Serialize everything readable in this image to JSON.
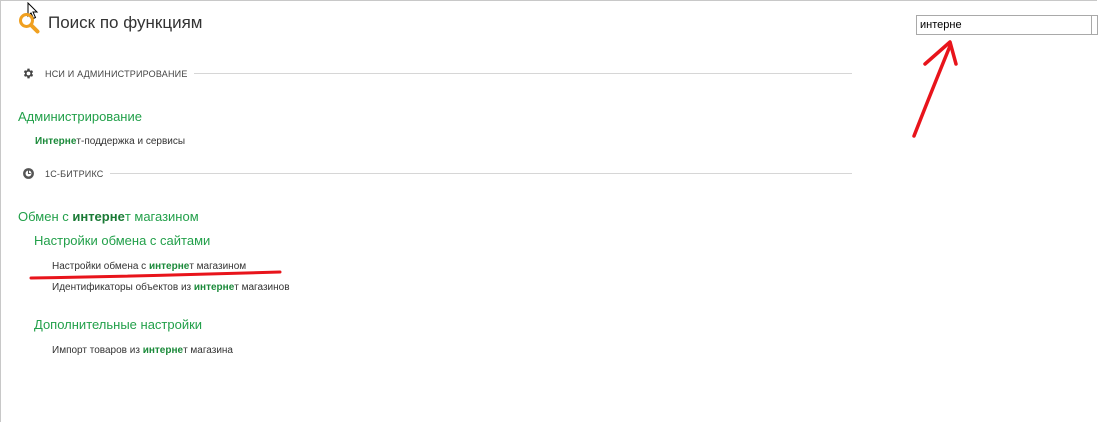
{
  "header": {
    "title": "Поиск по функциям",
    "icon": "search-icon"
  },
  "search": {
    "value": "интерне"
  },
  "sections": [
    {
      "label": "НСИ И АДМИНИСТРИРОВАНИЕ",
      "icon": "gear-icon"
    },
    {
      "label": "1С-БИТРИКС",
      "icon": "bitrix-icon"
    }
  ],
  "groups": {
    "admin": {
      "title": "Администрирование",
      "items": [
        {
          "match": "Интерне",
          "rest": "т-поддержка и сервисы"
        }
      ]
    },
    "exchange": {
      "title_pre": "Обмен с ",
      "title_match": "интерне",
      "title_post": "т магазином",
      "subgroups": [
        {
          "title": "Настройки обмена с сайтами",
          "items": [
            {
              "pre": "Настройки обмена с ",
              "match": "интерне",
              "post": "т магазином"
            },
            {
              "pre": "Идентификаторы объектов из ",
              "match": "интерне",
              "post": "т магазинов"
            }
          ]
        },
        {
          "title": "Дополнительные настройки",
          "items": [
            {
              "pre": "Импорт товаров из ",
              "match": "интерне",
              "post": "т магазина"
            }
          ]
        }
      ]
    }
  },
  "colors": {
    "group_title": "#22a04a",
    "match": "#1b8a3a",
    "annotation": "#e8141b",
    "search_icon": "#f0a020"
  }
}
